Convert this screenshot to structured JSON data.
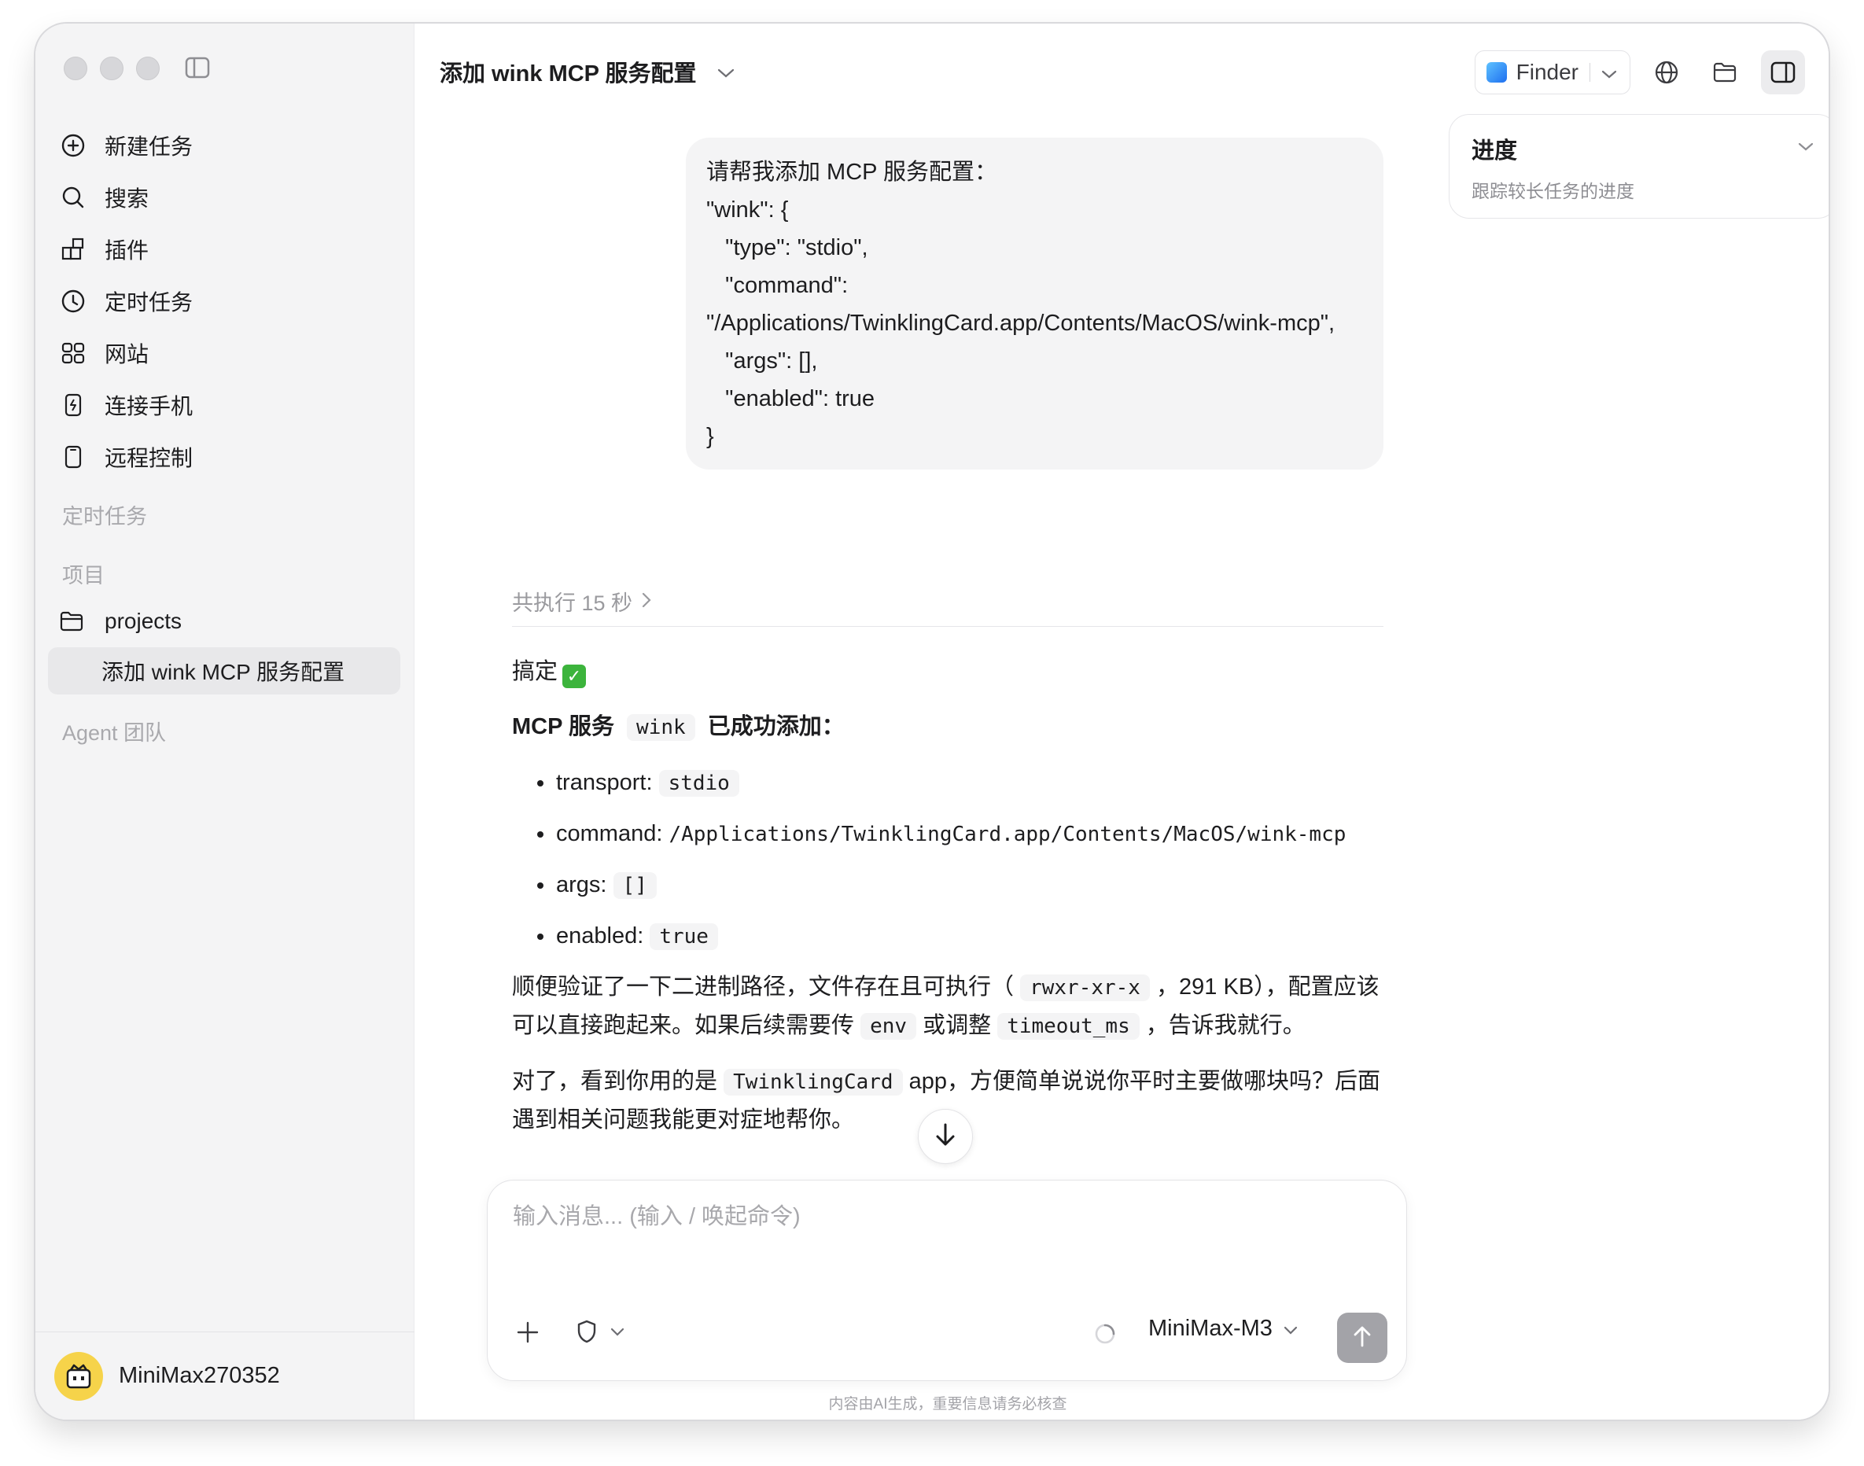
{
  "sidebar": {
    "nav": [
      {
        "label": "新建任务",
        "icon": "plus-circle-icon"
      },
      {
        "label": "搜索",
        "icon": "search-icon"
      },
      {
        "label": "插件",
        "icon": "plugin-icon"
      },
      {
        "label": "定时任务",
        "icon": "clock-icon"
      },
      {
        "label": "网站",
        "icon": "grid-icon"
      },
      {
        "label": "连接手机",
        "icon": "phone-link-icon"
      },
      {
        "label": "远程控制",
        "icon": "remote-device-icon"
      }
    ],
    "sections": {
      "scheduled": "定时任务",
      "projects": "项目",
      "agent_team": "Agent 团队"
    },
    "project_folder": "projects",
    "active_task": "添加 wink MCP 服务配置",
    "user": {
      "name": "MiniMax270352",
      "avatar_color": "#f6d34a"
    }
  },
  "header": {
    "title": "添加 wink MCP 服务配置",
    "finder_label": "Finder"
  },
  "chat": {
    "user_message": "请帮我添加 MCP 服务配置：\n\"wink\": {\n   \"type\": \"stdio\",\n   \"command\": \"/Applications/TwinklingCard.app/Contents/MacOS/wink-mcp\",\n   \"args\": [],\n   \"enabled\": true\n}",
    "exec_summary": "共执行 15 秒",
    "reply": {
      "done": "搞定",
      "done_emoji": "✓",
      "added_prefix": "MCP 服务",
      "added_code": "wink",
      "added_suffix": "已成功添加：",
      "bullets": [
        {
          "key": "transport:",
          "value": "stdio",
          "style": "code"
        },
        {
          "key": "command:",
          "value": "/Applications/TwinklingCard.app/Contents/MacOS/wink-mcp",
          "style": "mono"
        },
        {
          "key": "args:",
          "value": "[]",
          "style": "code"
        },
        {
          "key": "enabled:",
          "value": "true",
          "style": "code"
        }
      ],
      "para1_a": "顺便验证了一下二进制路径，文件存在且可执行（",
      "para1_code1": "rwxr-xr-x",
      "para1_b": "，291 KB），配置应该可以直接跑起来。如果后续需要传",
      "para1_code2": "env",
      "para1_c": "或调整",
      "para1_code3": "timeout_ms",
      "para1_d": "，告诉我就行。",
      "para2_a": "对了，看到你用的是",
      "para2_code": "TwinklingCard",
      "para2_b": "app，方便简单说说你平时主要做哪块吗？后面遇到相关问题我能更对症地帮你。"
    }
  },
  "composer": {
    "placeholder": "输入消息... (输入 / 唤起命令)",
    "model": "MiniMax-M3"
  },
  "disclaimer": "内容由AI生成，重要信息请务必核查",
  "progress": {
    "title": "进度",
    "subtitle": "跟踪较长任务的进度"
  },
  "colors": {
    "accent_check": "#3cb43c",
    "send_button": "#a3a3a8"
  }
}
